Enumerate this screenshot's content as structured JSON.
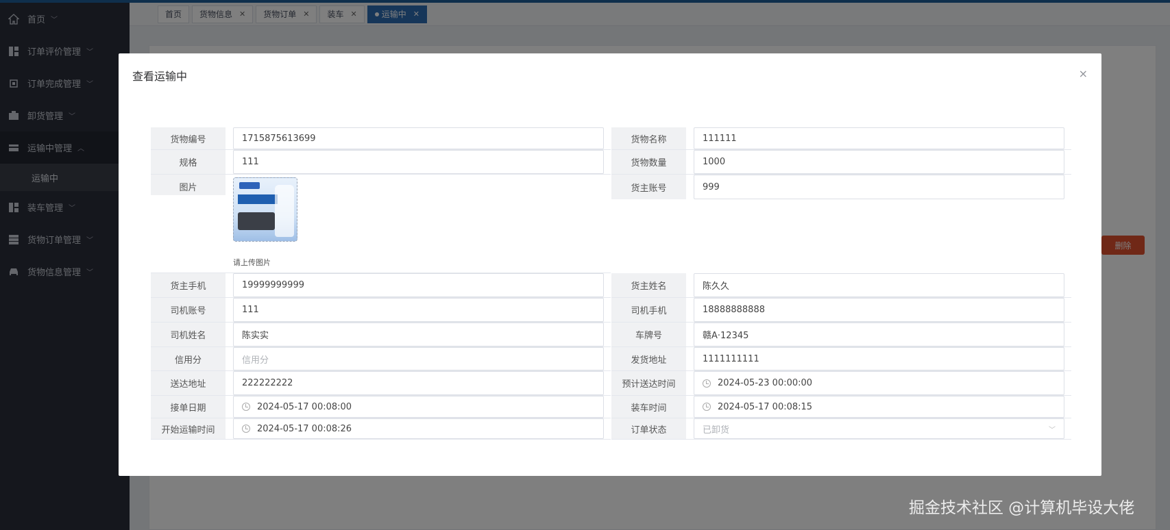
{
  "tabs": [
    {
      "label": "首页",
      "closable": false,
      "active": false
    },
    {
      "label": "货物信息",
      "closable": true,
      "active": false
    },
    {
      "label": "货物订单",
      "closable": true,
      "active": false
    },
    {
      "label": "装车",
      "closable": true,
      "active": false
    },
    {
      "label": "运输中",
      "closable": true,
      "active": true
    }
  ],
  "sidebar": {
    "items": [
      {
        "label": "首页",
        "icon": "home-icon"
      },
      {
        "label": "订单评价管理",
        "icon": "grid-icon"
      },
      {
        "label": "订单完成管理",
        "icon": "chip-icon"
      },
      {
        "label": "卸货管理",
        "icon": "box-icon"
      },
      {
        "label": "运输中管理",
        "icon": "card-icon",
        "open": true,
        "sub": [
          {
            "label": "运输中"
          }
        ]
      },
      {
        "label": "装车管理",
        "icon": "grid-icon"
      },
      {
        "label": "货物订单管理",
        "icon": "list-icon"
      },
      {
        "label": "货物信息管理",
        "icon": "car-icon"
      }
    ]
  },
  "background": {
    "delete_label": "删除"
  },
  "dialog": {
    "title": "查看运输中",
    "close": "×",
    "fields": {
      "goods_no": {
        "label": "货物编号",
        "value": "1715875613699"
      },
      "goods_name": {
        "label": "货物名称",
        "value": "111111"
      },
      "spec": {
        "label": "规格",
        "value": "111"
      },
      "goods_qty": {
        "label": "货物数量",
        "value": "1000"
      },
      "picture": {
        "label": "图片",
        "hint": "请上传图片"
      },
      "owner_account": {
        "label": "货主账号",
        "value": "999"
      },
      "owner_phone": {
        "label": "货主手机",
        "value": "19999999999"
      },
      "owner_name": {
        "label": "货主姓名",
        "value": "陈久久"
      },
      "driver_account": {
        "label": "司机账号",
        "value": "111"
      },
      "driver_phone": {
        "label": "司机手机",
        "value": "18888888888"
      },
      "driver_name": {
        "label": "司机姓名",
        "value": "陈实实"
      },
      "plate": {
        "label": "车牌号",
        "value": "赣A·12345"
      },
      "credit": {
        "label": "信用分",
        "placeholder": "信用分"
      },
      "ship_addr": {
        "label": "发货地址",
        "value": "1111111111"
      },
      "deliver_addr": {
        "label": "送达地址",
        "value": "222222222"
      },
      "eta": {
        "label": "预计送达时间",
        "value": "2024-05-23 00:00:00"
      },
      "accept_date": {
        "label": "接单日期",
        "value": "2024-05-17 00:08:00"
      },
      "load_time": {
        "label": "装车时间",
        "value": "2024-05-17 00:08:15"
      },
      "start_time": {
        "label": "开始运输时间",
        "value": "2024-05-17 00:08:26"
      },
      "status": {
        "label": "订单状态",
        "value": "已卸货"
      }
    }
  },
  "watermark": "掘金技术社区 @计算机毕设大佬"
}
